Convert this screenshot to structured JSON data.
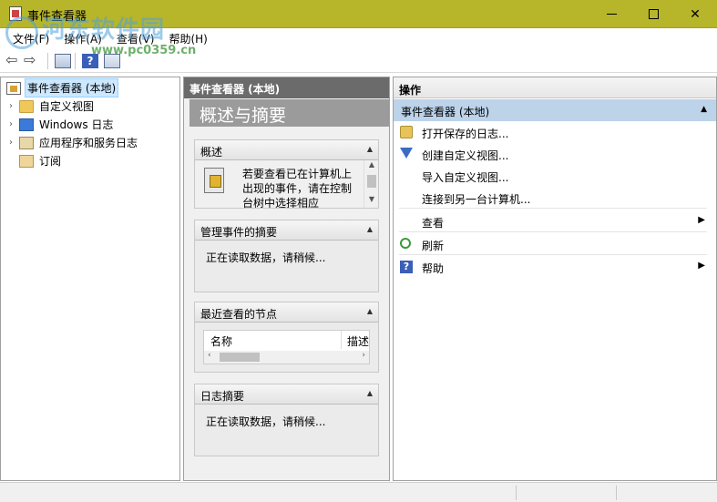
{
  "window": {
    "title": "事件查看器",
    "min_glyph": "–",
    "close_glyph": "✕"
  },
  "watermark": {
    "site_name": "河东软件园",
    "site_url": "www.pc0359.cn"
  },
  "menu": [
    "文件(F)",
    "操作(A)",
    "查看(V)",
    "帮助(H)"
  ],
  "toolbar": {
    "back_glyph": "⇦",
    "forward_glyph": "⇨",
    "help_glyph": "?"
  },
  "tree": {
    "root": "事件查看器 (本地)",
    "items": [
      "自定义视图",
      "Windows 日志",
      "应用程序和服务日志",
      "订阅"
    ]
  },
  "middle": {
    "header": "事件查看器 (本地)",
    "subtitle": "概述与摘要",
    "sections": {
      "overview": {
        "title": "概述",
        "text": "若要查看已在计算机上出现的事件，请在控制台树中选择相应"
      },
      "summary": {
        "title": "管理事件的摘要",
        "text": "正在读取数据，请稍候..."
      },
      "recent": {
        "title": "最近查看的节点",
        "col_name": "名称",
        "col_desc": "描述"
      },
      "log_summary": {
        "title": "日志摘要",
        "text": "正在读取数据，请稍候..."
      }
    }
  },
  "actions": {
    "header": "操作",
    "group": "事件查看器 (本地)",
    "items": [
      {
        "label": "打开保存的日志...",
        "icon": "open-folder-icon"
      },
      {
        "label": "创建自定义视图...",
        "icon": "filter-icon"
      },
      {
        "label": "导入自定义视图...",
        "icon": ""
      },
      {
        "label": "连接到另一台计算机...",
        "icon": ""
      },
      {
        "label": "查看",
        "icon": ""
      },
      {
        "label": "刷新",
        "icon": "refresh-icon"
      },
      {
        "label": "帮助",
        "icon": "help-icon"
      }
    ]
  }
}
